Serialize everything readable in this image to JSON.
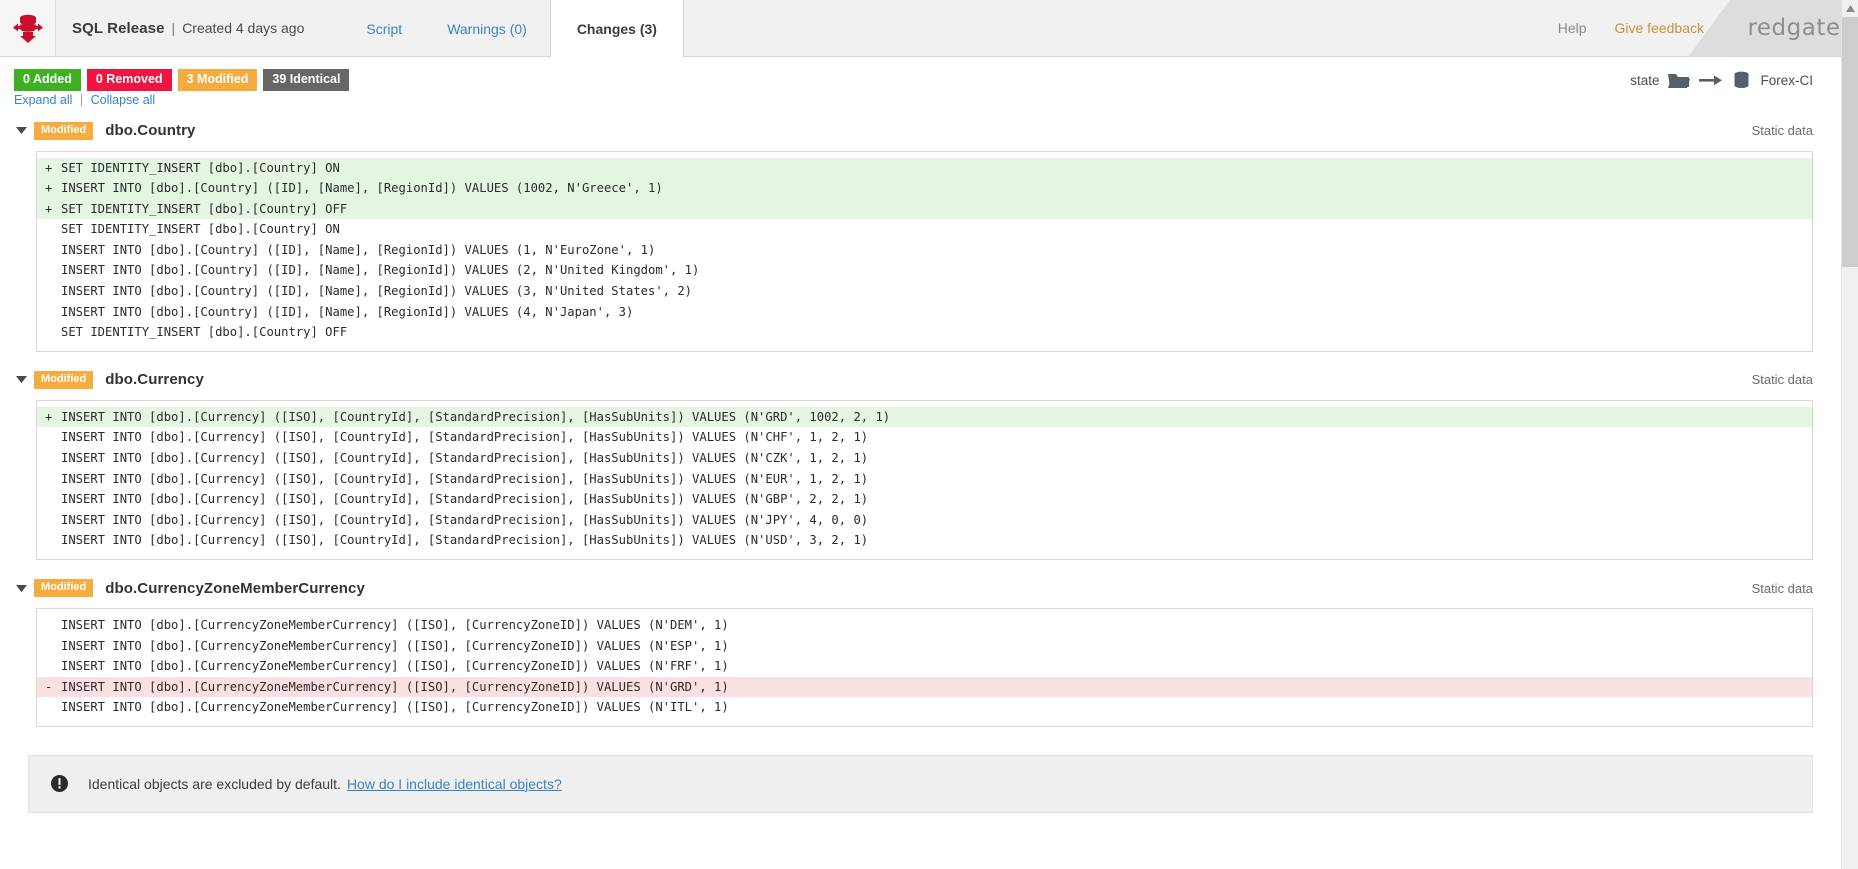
{
  "header": {
    "logo_icon": "database-sync-icon",
    "app_title": "SQL Release",
    "separator": "|",
    "created_text": "Created 4 days ago",
    "tabs": [
      {
        "label": "Script",
        "active": false
      },
      {
        "label": "Warnings (0)",
        "active": false
      },
      {
        "label": "Changes (3)",
        "active": true
      }
    ],
    "help_label": "Help",
    "feedback_label": "Give feedback",
    "brand": "redgate"
  },
  "summary": {
    "badges": [
      {
        "label": "0 Added",
        "color": "#3fb024"
      },
      {
        "label": "0 Removed",
        "color": "#f01440"
      },
      {
        "label": "3 Modified",
        "color": "#f5ab3e"
      },
      {
        "label": "39 Identical",
        "color": "#666666"
      }
    ],
    "expand_all": "Expand all",
    "collapse_all": "Collapse all",
    "separator": "|"
  },
  "state_indicator": {
    "source_label": "state",
    "source_icon": "folder-icon",
    "arrow_icon": "arrow-right-icon",
    "target_icon": "database-icon",
    "target_label": "Forex-CI"
  },
  "sections": [
    {
      "caret_icon": "caret-down-icon",
      "status": "Modified",
      "name": "dbo.Country",
      "type": "Static data",
      "lines": [
        {
          "sign": "+",
          "state": "added",
          "text": "SET IDENTITY_INSERT [dbo].[Country] ON"
        },
        {
          "sign": "+",
          "state": "added",
          "text": "INSERT INTO [dbo].[Country] ([ID], [Name], [RegionId]) VALUES (1002, N'Greece', 1)"
        },
        {
          "sign": "+",
          "state": "added",
          "text": "SET IDENTITY_INSERT [dbo].[Country] OFF"
        },
        {
          "sign": "",
          "state": "unchanged",
          "text": "SET IDENTITY_INSERT [dbo].[Country] ON"
        },
        {
          "sign": "",
          "state": "unchanged",
          "text": "INSERT INTO [dbo].[Country] ([ID], [Name], [RegionId]) VALUES (1, N'EuroZone', 1)"
        },
        {
          "sign": "",
          "state": "unchanged",
          "text": "INSERT INTO [dbo].[Country] ([ID], [Name], [RegionId]) VALUES (2, N'United Kingdom', 1)"
        },
        {
          "sign": "",
          "state": "unchanged",
          "text": "INSERT INTO [dbo].[Country] ([ID], [Name], [RegionId]) VALUES (3, N'United States', 2)"
        },
        {
          "sign": "",
          "state": "unchanged",
          "text": "INSERT INTO [dbo].[Country] ([ID], [Name], [RegionId]) VALUES (4, N'Japan', 3)"
        },
        {
          "sign": "",
          "state": "unchanged",
          "text": "SET IDENTITY_INSERT [dbo].[Country] OFF"
        }
      ]
    },
    {
      "caret_icon": "caret-down-icon",
      "status": "Modified",
      "name": "dbo.Currency",
      "type": "Static data",
      "lines": [
        {
          "sign": "+",
          "state": "added",
          "text": "INSERT INTO [dbo].[Currency] ([ISO], [CountryId], [StandardPrecision], [HasSubUnits]) VALUES (N'GRD', 1002, 2, 1)"
        },
        {
          "sign": "",
          "state": "unchanged",
          "text": "INSERT INTO [dbo].[Currency] ([ISO], [CountryId], [StandardPrecision], [HasSubUnits]) VALUES (N'CHF', 1, 2, 1)"
        },
        {
          "sign": "",
          "state": "unchanged",
          "text": "INSERT INTO [dbo].[Currency] ([ISO], [CountryId], [StandardPrecision], [HasSubUnits]) VALUES (N'CZK', 1, 2, 1)"
        },
        {
          "sign": "",
          "state": "unchanged",
          "text": "INSERT INTO [dbo].[Currency] ([ISO], [CountryId], [StandardPrecision], [HasSubUnits]) VALUES (N'EUR', 1, 2, 1)"
        },
        {
          "sign": "",
          "state": "unchanged",
          "text": "INSERT INTO [dbo].[Currency] ([ISO], [CountryId], [StandardPrecision], [HasSubUnits]) VALUES (N'GBP', 2, 2, 1)"
        },
        {
          "sign": "",
          "state": "unchanged",
          "text": "INSERT INTO [dbo].[Currency] ([ISO], [CountryId], [StandardPrecision], [HasSubUnits]) VALUES (N'JPY', 4, 0, 0)"
        },
        {
          "sign": "",
          "state": "unchanged",
          "text": "INSERT INTO [dbo].[Currency] ([ISO], [CountryId], [StandardPrecision], [HasSubUnits]) VALUES (N'USD', 3, 2, 1)"
        }
      ]
    },
    {
      "caret_icon": "caret-down-icon",
      "status": "Modified",
      "name": "dbo.CurrencyZoneMemberCurrency",
      "type": "Static data",
      "lines": [
        {
          "sign": "",
          "state": "unchanged",
          "text": "INSERT INTO [dbo].[CurrencyZoneMemberCurrency] ([ISO], [CurrencyZoneID]) VALUES (N'DEM', 1)"
        },
        {
          "sign": "",
          "state": "unchanged",
          "text": "INSERT INTO [dbo].[CurrencyZoneMemberCurrency] ([ISO], [CurrencyZoneID]) VALUES (N'ESP', 1)"
        },
        {
          "sign": "",
          "state": "unchanged",
          "text": "INSERT INTO [dbo].[CurrencyZoneMemberCurrency] ([ISO], [CurrencyZoneID]) VALUES (N'FRF', 1)"
        },
        {
          "sign": "-",
          "state": "removed",
          "text": "INSERT INTO [dbo].[CurrencyZoneMemberCurrency] ([ISO], [CurrencyZoneID]) VALUES (N'GRD', 1)"
        },
        {
          "sign": "",
          "state": "unchanged",
          "text": "INSERT INTO [dbo].[CurrencyZoneMemberCurrency] ([ISO], [CurrencyZoneID]) VALUES (N'ITL', 1)"
        }
      ]
    }
  ],
  "notice": {
    "icon": "info-icon",
    "text": "Identical objects are excluded by default.",
    "link": "How do I include identical objects?"
  }
}
